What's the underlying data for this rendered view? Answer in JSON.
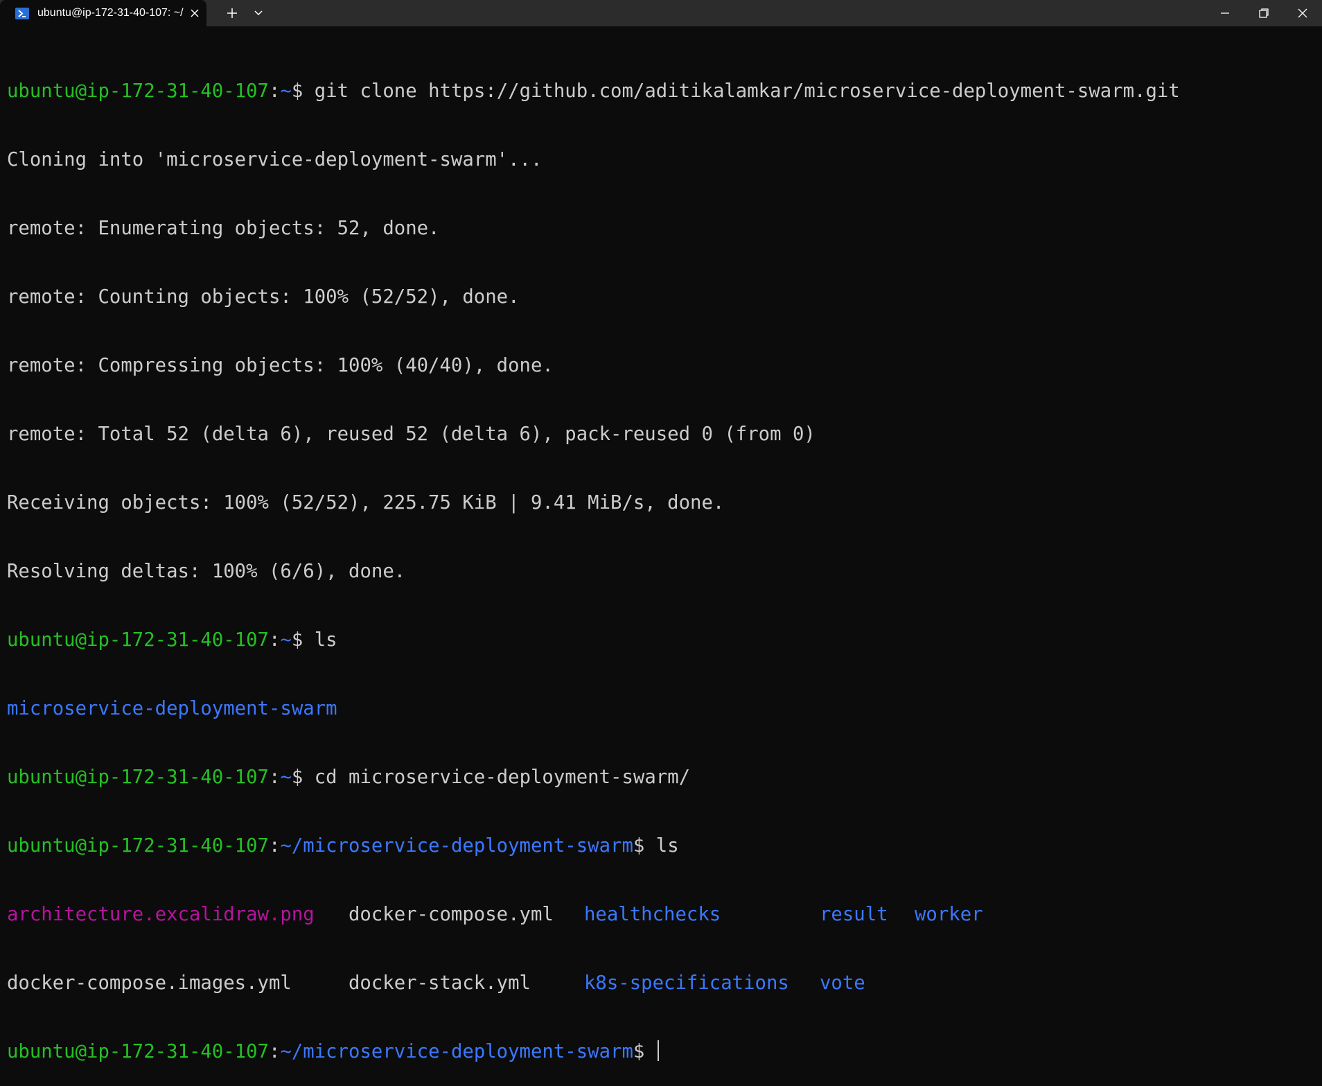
{
  "window": {
    "tab_title": "ubuntu@ip-172-31-40-107: ~/",
    "icons": {
      "tab": "powershell-icon",
      "close": "close-icon",
      "new_tab": "plus-icon",
      "dropdown": "chevron-down-icon",
      "minimize": "minimize-icon",
      "restore": "restore-icon",
      "window_close": "close-icon"
    }
  },
  "colors": {
    "background": "#0c0c0c",
    "prompt_user": "#25c024",
    "prompt_path": "#3b78ff",
    "text": "#cccccc",
    "directory": "#3b78ff",
    "image_file": "#b4149e"
  },
  "terminal": {
    "prompt_user": "ubuntu@ip-172-31-40-107",
    "home_path": "~",
    "repo_path": "~/microservice-deployment-swarm",
    "cmd1": "git clone https://github.com/aditikalamkar/microservice-deployment-swarm.git",
    "clone_output": [
      "Cloning into 'microservice-deployment-swarm'...",
      "remote: Enumerating objects: 52, done.",
      "remote: Counting objects: 100% (52/52), done.",
      "remote: Compressing objects: 100% (40/40), done.",
      "remote: Total 52 (delta 6), reused 52 (delta 6), pack-reused 0 (from 0)",
      "Receiving objects: 100% (52/52), 225.75 KiB | 9.41 MiB/s, done.",
      "Resolving deltas: 100% (6/6), done."
    ],
    "cmd2": "ls",
    "ls1_output": "microservice-deployment-swarm",
    "cmd3": "cd microservice-deployment-swarm/",
    "cmd4": "ls",
    "ls2_row1": [
      "architecture.excalidraw.png",
      "docker-compose.yml",
      "healthchecks",
      "result",
      "worker"
    ],
    "ls2_row2": [
      "docker-compose.images.yml",
      "docker-stack.yml",
      "k8s-specifications",
      "vote"
    ]
  }
}
